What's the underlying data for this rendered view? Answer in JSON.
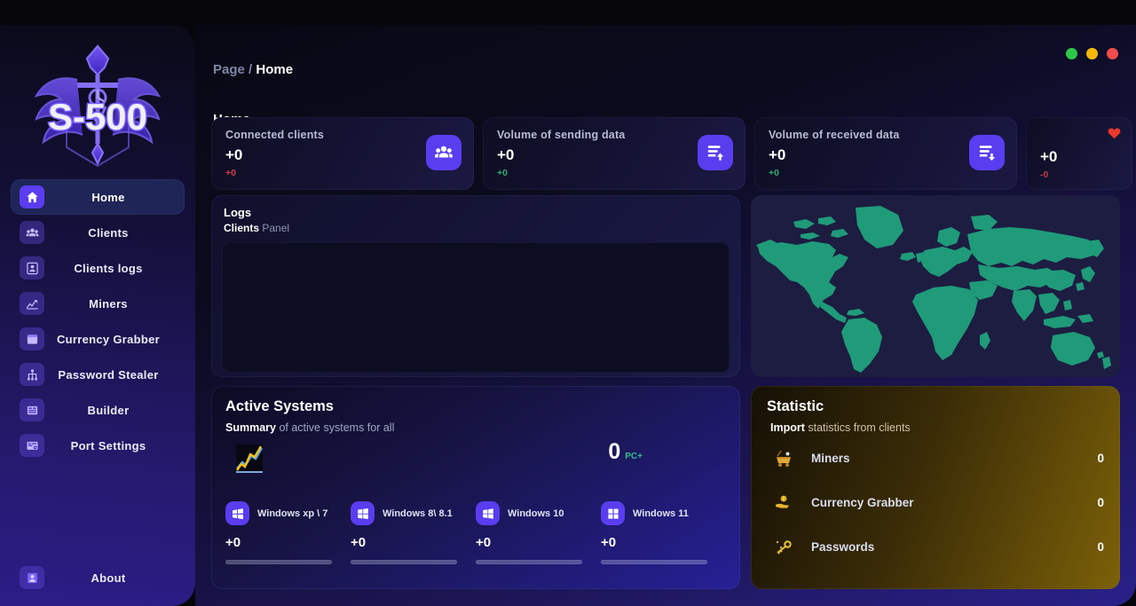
{
  "app": {
    "logo_text": "S-500"
  },
  "window": {
    "dots": [
      {
        "name": "minimize",
        "color": "#2bc84a"
      },
      {
        "name": "maximize",
        "color": "#f2b90c"
      },
      {
        "name": "close",
        "color": "#f14c4c"
      }
    ]
  },
  "breadcrumb": {
    "root": "Page /",
    "current": "Home"
  },
  "page_title": "Home",
  "sidebar": {
    "items": [
      {
        "label": "Home",
        "icon": "home-icon",
        "active": true
      },
      {
        "label": "Clients",
        "icon": "clients-icon",
        "active": false
      },
      {
        "label": "Clients logs",
        "icon": "clients-logs-icon",
        "active": false
      },
      {
        "label": "Miners",
        "icon": "miners-icon",
        "active": false
      },
      {
        "label": "Currency Grabber",
        "icon": "currency-grabber-icon",
        "active": false
      },
      {
        "label": "Password Stealer",
        "icon": "password-stealer-icon",
        "active": false
      },
      {
        "label": "Builder",
        "icon": "builder-icon",
        "active": false
      },
      {
        "label": "Port Settings",
        "icon": "port-settings-icon",
        "active": false
      }
    ],
    "about": {
      "label": "About",
      "icon": "user-icon"
    }
  },
  "cards": [
    {
      "title": "Connected clients",
      "value": "+0",
      "delta": "+0",
      "delta_color": "#d43b4e",
      "icon": "group-users-icon"
    },
    {
      "title": "Volume of sending data",
      "value": "+0",
      "delta": "+0",
      "delta_color": "#2fae6f",
      "icon": "upload-list-icon"
    },
    {
      "title": "Volume of received data",
      "value": "+0",
      "delta": "+0",
      "delta_color": "#2fae6f",
      "icon": "download-list-icon"
    },
    {
      "title": "",
      "value": "+0",
      "delta": "-0",
      "delta_color": "#c4384a",
      "icon": "heart-icon"
    }
  ],
  "logs": {
    "title": "Logs",
    "subtitle_bold": "Clients",
    "subtitle_rest": " Panel"
  },
  "map": {
    "land_color": "#1f9b7a",
    "sea_color": "#1d1d42"
  },
  "active_systems": {
    "title": "Active Systems",
    "subtitle_bold": "Summary",
    "subtitle_rest": " of active systems for all",
    "count": "0",
    "count_unit": "PC+",
    "chart_icon": "line-chart-icon",
    "systems": [
      {
        "name": "Windows xp \\ 7",
        "value": "+0",
        "icon": "windows-xp-icon",
        "progress": 0
      },
      {
        "name": "Windows 8\\ 8.1",
        "value": "+0",
        "icon": "windows-8-icon",
        "progress": 0
      },
      {
        "name": "Windows 10",
        "value": "+0",
        "icon": "windows-10-icon",
        "progress": 0
      },
      {
        "name": "Windows 11",
        "value": "+0",
        "icon": "windows-11-icon",
        "progress": 0
      }
    ]
  },
  "statistic": {
    "title": "Statistic",
    "subtitle_bold": "Import",
    "subtitle_rest": " statistics from clients",
    "rows": [
      {
        "name": "Miners",
        "value": "0",
        "icon": "mine-cart-icon"
      },
      {
        "name": "Currency Grabber",
        "value": "0",
        "icon": "hand-coin-icon"
      },
      {
        "name": "Passwords",
        "value": "0",
        "icon": "key-icon"
      }
    ]
  }
}
